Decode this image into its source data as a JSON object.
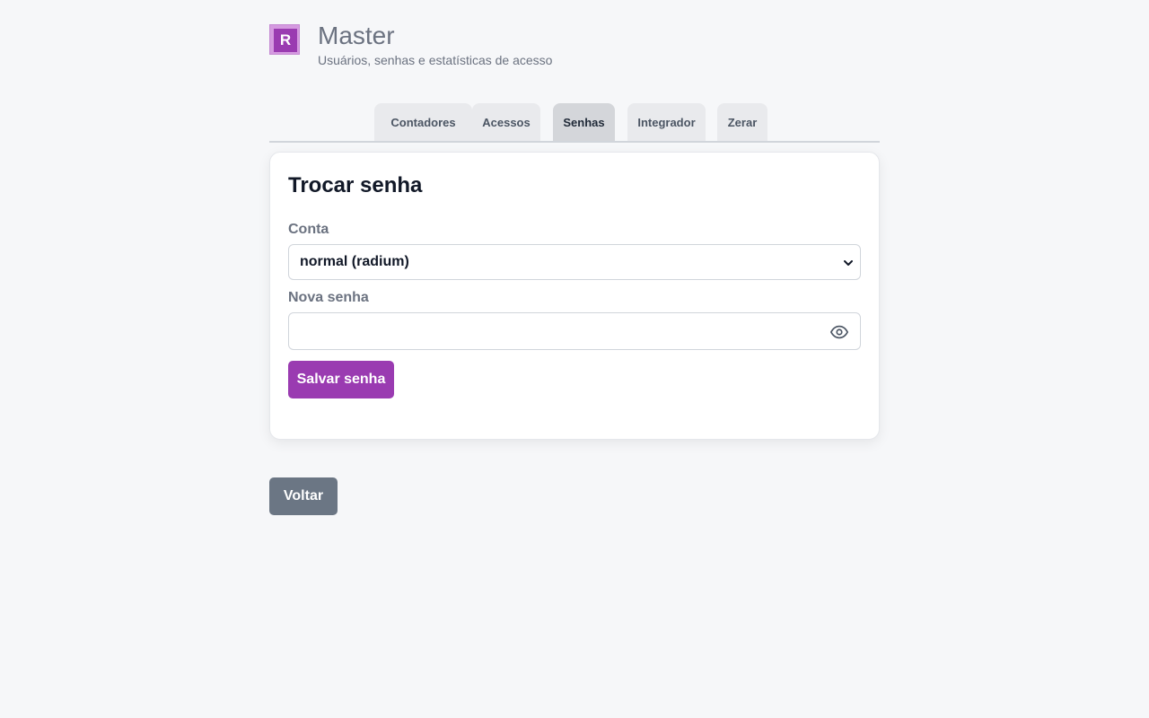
{
  "header": {
    "logo_letter": "R",
    "title": "Master",
    "subtitle": "Usuários, senhas e estatísticas de acesso"
  },
  "tabs": [
    {
      "label": "Contadores",
      "active": false
    },
    {
      "label": "Acessos",
      "active": false
    },
    {
      "label": "Senhas",
      "active": true
    },
    {
      "label": "Integrador",
      "active": false
    },
    {
      "label": "Zerar",
      "active": false
    }
  ],
  "card": {
    "title": "Trocar senha",
    "account_label": "Conta",
    "account_value": "normal (radium)",
    "password_label": "Nova senha",
    "password_value": "",
    "save_label": "Salvar senha"
  },
  "back_label": "Voltar",
  "colors": {
    "accent": "#9a3bb1",
    "logo_outer": "#d59ae0",
    "back_button": "#6b7684",
    "background": "#f6f7f9"
  },
  "icons": {
    "password_toggle": "eye-icon",
    "select_arrow": "chevron-down-icon"
  }
}
